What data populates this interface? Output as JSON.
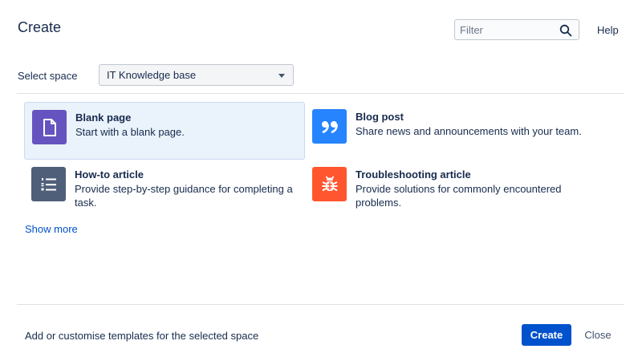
{
  "dialog": {
    "title": "Create",
    "help_label": "Help"
  },
  "filter": {
    "placeholder": "Filter",
    "value": "",
    "icon": "search-icon"
  },
  "space": {
    "label": "Select space",
    "selected": "IT Knowledge base"
  },
  "templates": [
    {
      "title": "Blank page",
      "description": "Start with a blank page.",
      "icon": "document-icon",
      "icon_color": "#6554c0",
      "selected": true
    },
    {
      "title": "Blog post",
      "description": "Share news and announcements with your team.",
      "icon": "quote-icon",
      "icon_color": "#2684ff",
      "selected": false
    },
    {
      "title": "How-to article",
      "description": "Provide step-by-step guidance for completing a task.",
      "icon": "numbered-list-icon",
      "icon_color": "#505f79",
      "selected": false
    },
    {
      "title": "Troubleshooting article",
      "description": "Provide solutions for commonly encountered problems.",
      "icon": "bug-icon",
      "icon_color": "#ff5630",
      "selected": false
    }
  ],
  "show_more_label": "Show more",
  "footer": {
    "customise_text": "Add or customise templates for the selected space",
    "create_label": "Create",
    "close_label": "Close"
  },
  "colors": {
    "primary": "#0052cc",
    "selected_bg": "#eaf2fb",
    "text": "#172b4d"
  }
}
